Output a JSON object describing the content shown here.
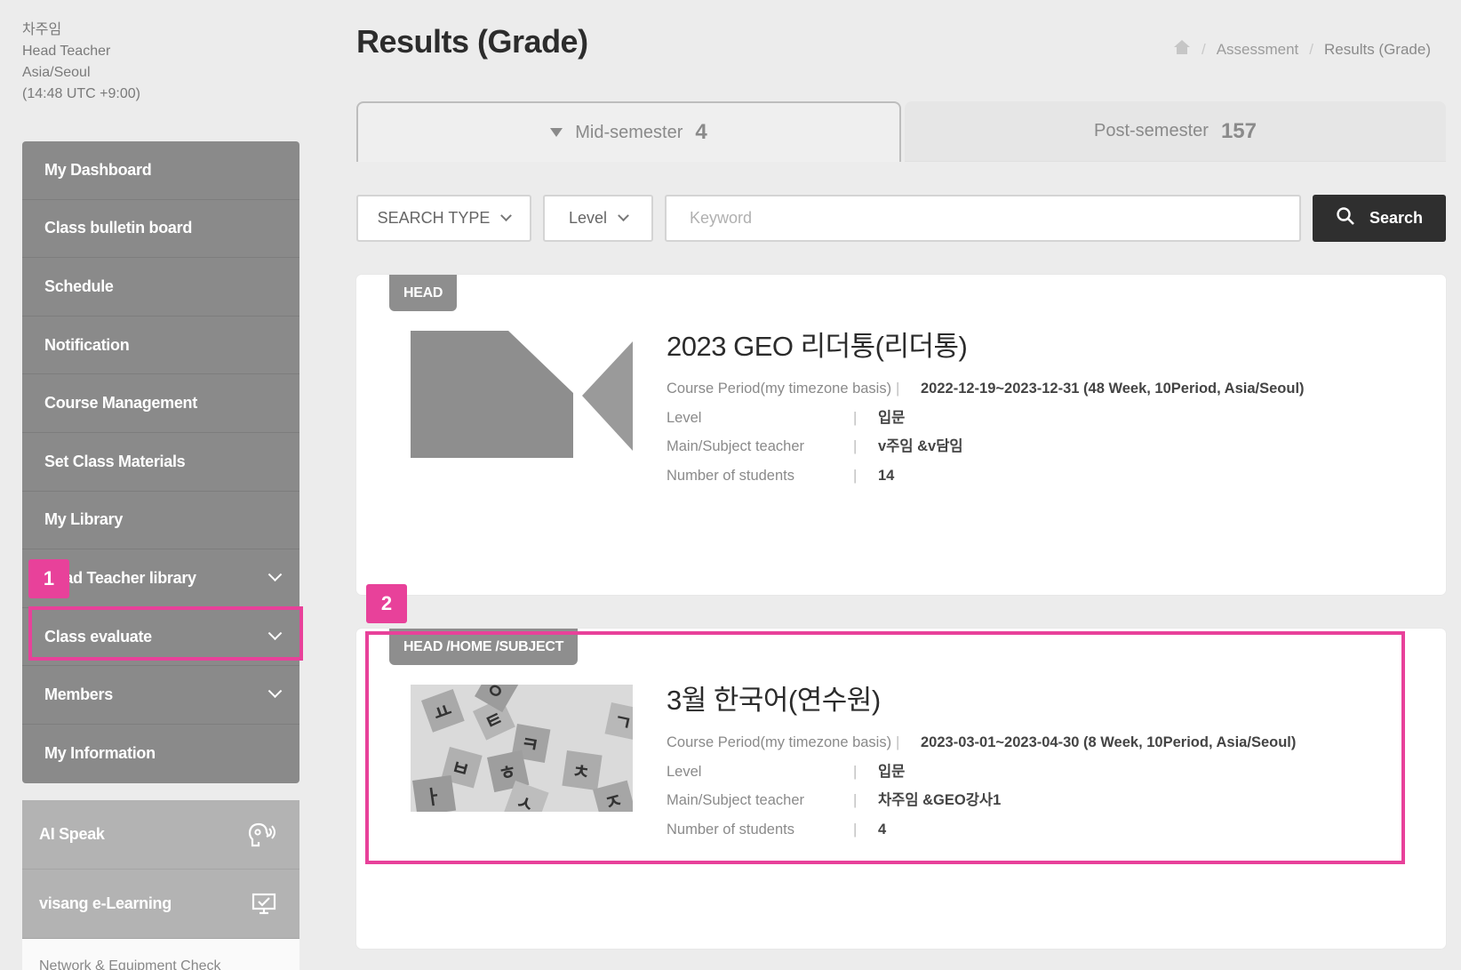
{
  "user": {
    "name": "차주임",
    "role": "Head Teacher",
    "timezone": "Asia/Seoul",
    "time": "(14:48 UTC +9:00)"
  },
  "sidebar": {
    "items": [
      {
        "label": "My Dashboard",
        "expandable": false
      },
      {
        "label": "Class bulletin board",
        "expandable": false
      },
      {
        "label": "Schedule",
        "expandable": false
      },
      {
        "label": "Notification",
        "expandable": false
      },
      {
        "label": "Course Management",
        "expandable": false
      },
      {
        "label": "Set Class Materials",
        "expandable": false
      },
      {
        "label": "My Library",
        "expandable": false
      },
      {
        "label": "Head Teacher library",
        "expandable": true
      },
      {
        "label": "Class evaluate",
        "expandable": true
      },
      {
        "label": "Members",
        "expandable": true
      },
      {
        "label": "My Information",
        "expandable": false
      }
    ],
    "tools": [
      {
        "label": "AI Speak",
        "icon": "ai-speak-icon"
      },
      {
        "label": "visang e-Learning",
        "icon": "monitor-check-icon"
      }
    ],
    "tools_cut_label": "Network & Equipment Check"
  },
  "markers": {
    "one": "1",
    "two": "2"
  },
  "page": {
    "title": "Results (Grade)",
    "breadcrumb": [
      "Assessment",
      "Results (Grade)"
    ]
  },
  "tabs": [
    {
      "label": "Mid-semester",
      "count": "4",
      "active": true
    },
    {
      "label": "Post-semester",
      "count": "157",
      "active": false
    }
  ],
  "filters": {
    "search_type": "SEARCH TYPE",
    "level": "Level",
    "keyword_placeholder": "Keyword",
    "search_label": "Search"
  },
  "courses": [
    {
      "tag": "HEAD",
      "title": "2023 GEO 리더통(리더통)",
      "period_label": "Course Period(my timezone basis)",
      "period": "2022-12-19~2023-12-31 (48 Week,  10Period,  Asia/Seoul)",
      "level_label": "Level",
      "level": "입문",
      "teacher_label": "Main/Subject teacher",
      "teacher": "v주임 &v담임",
      "students_label": "Number of students",
      "students": "14"
    },
    {
      "tag": "HEAD /HOME /SUBJECT",
      "title": "3월 한국어(연수원)",
      "period_label": "Course Period(my timezone basis)",
      "period": "2023-03-01~2023-04-30 (8 Week,  10Period,  Asia/Seoul)",
      "level_label": "Level",
      "level": "입문",
      "teacher_label": "Main/Subject teacher",
      "teacher": "차주임 &GEO강사1",
      "students_label": "Number of students",
      "students": "4"
    }
  ],
  "colors": {
    "accent": "#e8419a",
    "sidebar_bg": "#8a8a8a",
    "search_btn": "#2f2f2f"
  }
}
